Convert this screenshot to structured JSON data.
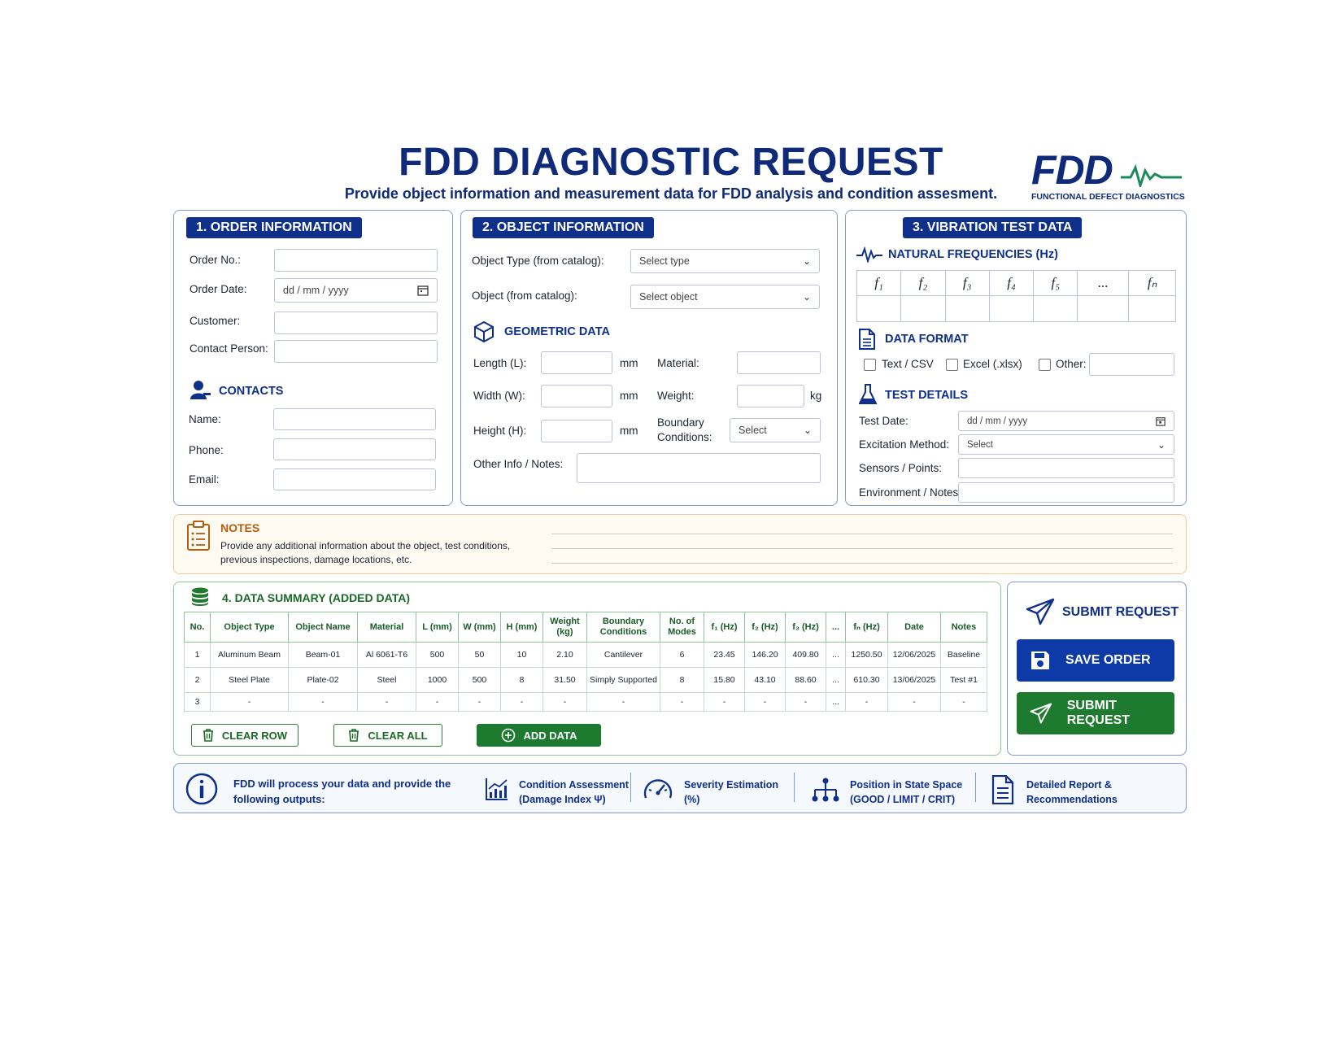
{
  "header": {
    "title": "FDD DIAGNOSTIC REQUEST",
    "subtitle": "Provide object information and measurement data for FDD analysis and condition assesment.",
    "logo_text": "FDD",
    "logo_sub": "FUNCTIONAL DEFECT DIAGNOSTICS"
  },
  "order": {
    "heading": "1. ORDER INFORMATION",
    "order_no": "Order No.:",
    "order_date": "Order Date:",
    "date_placeholder": "dd / mm / yyyy",
    "customer": "Customer:",
    "contact_person": "Contact Person:",
    "contacts_heading": "CONTACTS",
    "name": "Name:",
    "phone": "Phone:",
    "email": "Email:"
  },
  "object": {
    "heading": "2. OBJECT INFORMATION",
    "type_label": "Object Type (from catalog):",
    "type_value": "Select type",
    "object_label": "Object (from catalog):",
    "object_value": "Select object",
    "geo_heading": "GEOMETRIC DATA",
    "length": "Length (L):",
    "width": "Width (W):",
    "height": "Height (H):",
    "mm": "mm",
    "kg": "kg",
    "material": "Material:",
    "weight": "Weight:",
    "boundary_line1": "Boundary",
    "boundary_line2": "Conditions:",
    "boundary_value": "Select",
    "notes": "Other Info / Notes:"
  },
  "vibration": {
    "heading": "3. VIBRATION TEST DATA",
    "freq_heading": "NATURAL FREQUENCIES (Hz)",
    "freq_cols": [
      "f₁",
      "f₂",
      "f₃",
      "f₄",
      "f₅",
      "...",
      "fₙ"
    ],
    "format_heading": "DATA FORMAT",
    "fmt_csv": "Text / CSV",
    "fmt_excel": "Excel (.xlsx)",
    "fmt_other": "Other:",
    "details_heading": "TEST DETAILS",
    "test_date": "Test Date:",
    "date_placeholder": "dd / mm / yyyy",
    "excitation": "Excitation Method:",
    "excitation_value": "Select",
    "sensors": "Sensors / Points:",
    "environment": "Environment / Notes:"
  },
  "notes": {
    "heading": "NOTES",
    "line1": "Provide any additional information about the object, test conditions,",
    "line2": "previous inspections, damage locations, etc."
  },
  "summary": {
    "heading": "4. DATA SUMMARY (ADDED DATA)",
    "columns": [
      "No.",
      "Object Type",
      "Object Name",
      "Material",
      "L (mm)",
      "W (mm)",
      "H (mm)",
      "Weight (kg)",
      "Boundary Conditions",
      "No. of Modes",
      "f₁ (Hz)",
      "f₂ (Hz)",
      "f₃ (Hz)",
      "...",
      "fₙ (Hz)",
      "Date",
      "Notes"
    ],
    "rows": [
      [
        "1",
        "Aluminum Beam",
        "Beam-01",
        "Al 6061-T6",
        "500",
        "50",
        "10",
        "2.10",
        "Cantilever",
        "6",
        "23.45",
        "146.20",
        "409.80",
        "...",
        "1250.50",
        "12/06/2025",
        "Baseline"
      ],
      [
        "2",
        "Steel Plate",
        "Plate-02",
        "Steel",
        "1000",
        "500",
        "8",
        "31.50",
        "Simply Supported",
        "8",
        "15.80",
        "43.10",
        "88.60",
        "...",
        "610.30",
        "13/06/2025",
        "Test #1"
      ],
      [
        "3",
        "-",
        "-",
        "-",
        "-",
        "-",
        "-",
        "-",
        "-",
        "-",
        "-",
        "-",
        "-",
        "...",
        "-",
        "-",
        "-"
      ]
    ],
    "clear_row": "CLEAR ROW",
    "clear_all": "CLEAR ALL",
    "add_data": "ADD DATA"
  },
  "actions": {
    "submit_heading": "SUBMIT REQUEST",
    "save": "SAVE ORDER",
    "submit": "SUBMIT REQUEST"
  },
  "footer": {
    "intro_line1": "FDD will process your data and provide the",
    "intro_line2": "following outputs:",
    "o1_line1": "Condition Assessment",
    "o1_line2": "(Damage Index Ψ)",
    "o2_line1": "Severity Estimation",
    "o2_line2": "(%)",
    "o3_line1": "Position in State Space",
    "o3_line2": "(GOOD / LIMIT / CRIT)",
    "o4_line1": "Detailed Report &",
    "o4_line2": "Recommendations"
  },
  "icons": [
    "logo-wave-icon",
    "user-icon",
    "cube-icon",
    "waveform-icon",
    "document-icon",
    "flask-icon",
    "clipboard-icon",
    "database-icon",
    "trash-icon",
    "plus-circle-icon",
    "send-icon",
    "save-icon",
    "info-icon",
    "chart-icon",
    "gauge-icon",
    "hierarchy-icon",
    "report-icon",
    "calendar-icon",
    "chevron-down-icon"
  ],
  "colors": {
    "primary": "#0e2f8a",
    "green": "#1e7a2e",
    "notes_accent": "#b85c0a"
  }
}
